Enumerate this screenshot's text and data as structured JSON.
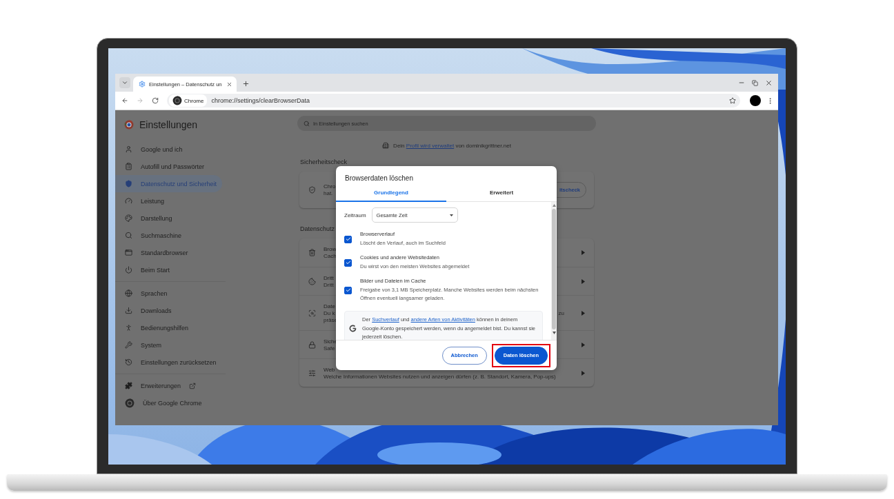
{
  "tabs": [
    {
      "title": "Einstellungen – Datenschutz un",
      "selected": true
    }
  ],
  "navigation": [
    {
      "kind": "back",
      "disabled": false
    },
    {
      "kind": "forward",
      "disabled": true
    },
    {
      "kind": "reload",
      "disabled": false
    }
  ],
  "address_bar": {
    "chip": "Chrome",
    "url": "chrome://settings/clearBrowserData"
  },
  "settings": {
    "title": "Einstellungen",
    "search": {
      "placeholder": "In Einstellungen suchen"
    },
    "sidebar": {
      "groups": [
        {
          "items": [
            {
              "label": "Google und ich",
              "selected": false
            },
            {
              "label": "Autofill und Passwörter",
              "selected": false
            },
            {
              "label": "Datenschutz und Sicherheit",
              "selected": true
            },
            {
              "label": "Leistung",
              "selected": false
            },
            {
              "label": "Darstellung",
              "selected": false
            },
            {
              "label": "Suchmaschine",
              "selected": false
            },
            {
              "label": "Standardbrowser",
              "selected": false
            },
            {
              "label": "Beim Start",
              "selected": false
            }
          ]
        },
        {
          "items": [
            {
              "label": "Sprachen",
              "selected": false
            },
            {
              "label": "Downloads",
              "selected": false
            },
            {
              "label": "Bedienungshilfen",
              "selected": false
            },
            {
              "label": "System",
              "selected": false
            },
            {
              "label": "Einstellungen zurücksetzen",
              "selected": false
            }
          ]
        },
        {
          "items": [
            {
              "label": "Erweiterungen",
              "selected": false
            },
            {
              "label": "Über Google Chrome",
              "selected": false
            }
          ]
        }
      ]
    },
    "managed_notice": {
      "before": "Dein",
      "link": "Profil wird verwaltet",
      "after": "von dominikgrittner.net"
    },
    "sections": [
      {
        "heading": "Sicherheitscheck",
        "rows": [
          {
            "kind": "button",
            "title": "Chro",
            "description": [
              "hat."
            ],
            "button": "itscheck"
          }
        ]
      },
      {
        "heading": "Datenschutz",
        "rows": [
          {
            "kind": "link",
            "title": "Brow",
            "description": [
              "Cach"
            ]
          },
          {
            "kind": "link",
            "title": "Dritt",
            "description": [
              "Dritt"
            ]
          },
          {
            "kind": "link",
            "title": "Date",
            "description": [
              "Du k",
              "präse"
            ],
            "trailing": "zu"
          },
          {
            "kind": "link",
            "title": "Siche",
            "description": [
              "Safe"
            ]
          },
          {
            "kind": "link",
            "title": "Web",
            "description": [
              "Welche Informationen Websites nutzen und anzeigen dürfen (z. B. Standort, Kamera, Pop-ups)"
            ]
          }
        ]
      }
    ]
  },
  "dialog": {
    "title": "Browserdaten löschen",
    "tabs": [
      {
        "label": "Grundlegend",
        "selected": true
      },
      {
        "label": "Erweitert",
        "selected": false
      }
    ],
    "time_range": {
      "label": "Zeitraum",
      "value": "Gesamte Zeit"
    },
    "options": [
      {
        "title": "Browserverlauf",
        "description": "Löscht den Verlauf, auch im Suchfeld",
        "checked": true
      },
      {
        "title": "Cookies und andere Websitedaten",
        "description": "Du wirst von den meisten Websites abgemeldet",
        "checked": true
      },
      {
        "title": "Bilder und Dateien im Cache",
        "description": "Freigabe von 3,1 MB Speicherplatz. Manche Websites werden beim nächsten Öffnen eventuell langsamer geladen.",
        "checked": true
      }
    ],
    "info": {
      "segments": [
        {
          "text": "Der",
          "link": false
        },
        {
          "text": "Suchverlauf",
          "link": true
        },
        {
          "text": "und",
          "link": false
        },
        {
          "text": "andere Arten von Aktivitäten",
          "link": true
        },
        {
          "text": "können in deinem Google-Konto gespeichert werden, wenn du angemeldet bist. Du kannst sie jederzeit löschen.",
          "link": false
        }
      ]
    },
    "actions": [
      {
        "label": "Abbrechen",
        "kind": "secondary",
        "highlighted": false
      },
      {
        "label": "Daten löschen",
        "kind": "primary",
        "highlighted": true
      }
    ]
  }
}
